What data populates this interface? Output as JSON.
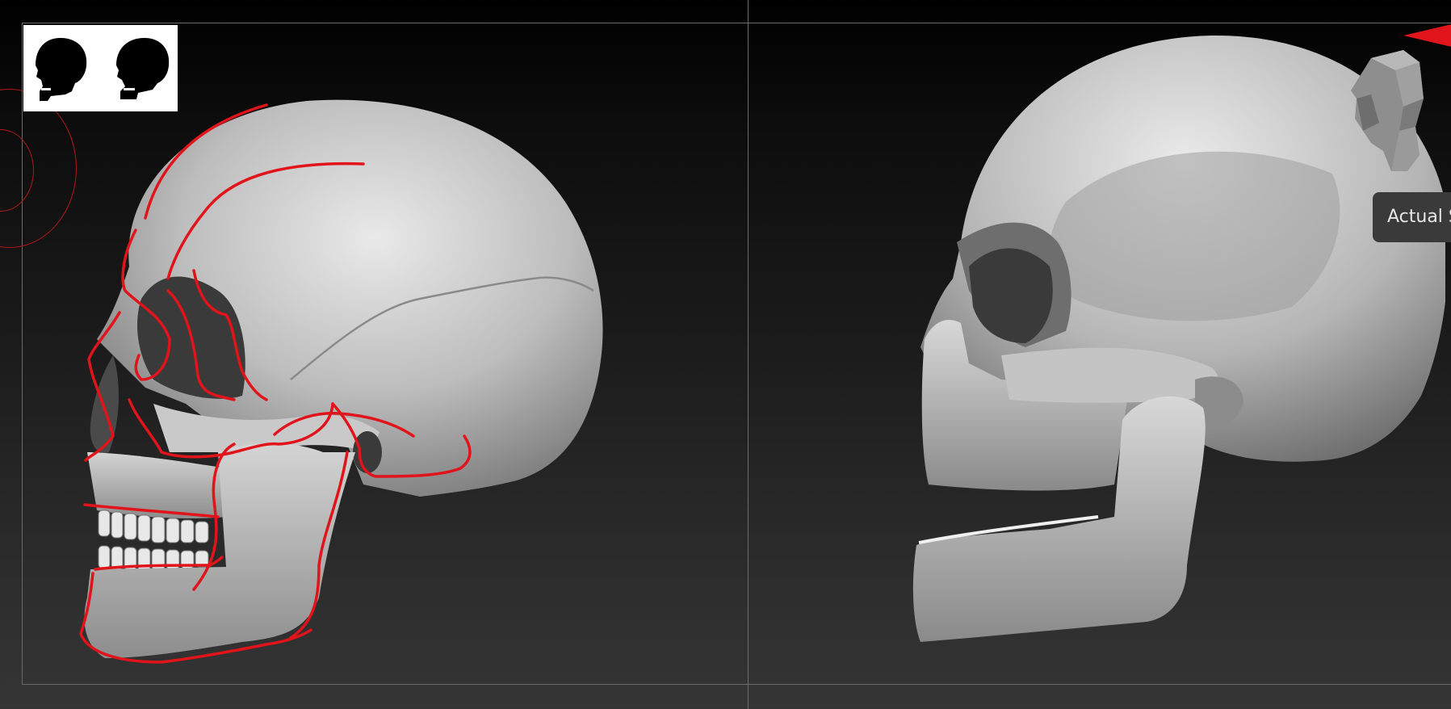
{
  "viewport": {
    "left_panel": "annotated-skull-reference",
    "right_panel": "stylized-skull-sculpt"
  },
  "thumbnails": [
    "skull-silhouette-icon",
    "skull-silhouette-icon"
  ],
  "navigation": {
    "gizmo": "head-navigation-gizmo",
    "indicator": "red-arrow-indicator"
  },
  "tooltip": {
    "text": "Actual S"
  },
  "colors": {
    "annotation": "#e0141a",
    "frame": "#6b6b6b",
    "tooltip_bg": "#3a3a3a"
  }
}
